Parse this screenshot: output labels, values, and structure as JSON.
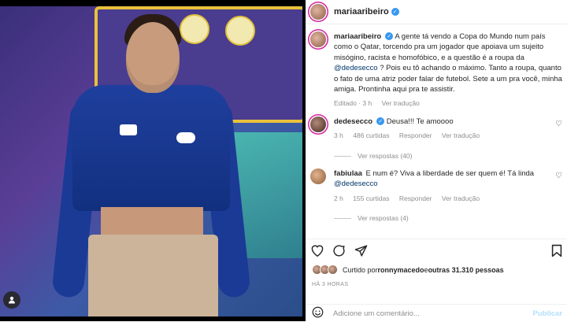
{
  "post": {
    "author": "mariaaribeiro",
    "caption": "A gente tá vendo a Copa do Mundo num país como o Qatar, torcendo pra um jogador que apoiava um sujeito misógino, racista e homofóbico, e a questão é a roupa da",
    "caption_mention": "@dedesecco",
    "caption_rest": " ? Pois eu tô achando o máximo. Tanto a roupa, quanto o fato de uma atriz poder falar de futebol. Sete a um pra você, minha amiga. Prontinha aqui pra te assistir.",
    "caption_edited": "Editado · 3 h",
    "caption_translate": "Ver tradução"
  },
  "comments": [
    {
      "user": "dedesecco",
      "text": "Deusa!!! Te amoooo",
      "time": "3 h",
      "likes": "486 curtidas",
      "reply": "Responder",
      "translate": "Ver tradução",
      "view_replies": "Ver respostas (40)"
    },
    {
      "user": "fabiulaa",
      "text": "E num é? Viva a liberdade de ser quem é! Tá linda",
      "mention": "@dedesecco",
      "time": "2 h",
      "likes": "155 curtidas",
      "reply": "Responder",
      "translate": "Ver tradução",
      "view_replies": "Ver respostas (4)"
    }
  ],
  "likes": {
    "prefix": "Curtido por ",
    "user": "ronnymacedo",
    "middle": " e ",
    "others": "outras 31.310 pessoas"
  },
  "timestamp": "HÁ 3 HORAS",
  "add_comment": {
    "placeholder": "Adicione um comentário...",
    "post_label": "Publicar"
  },
  "icons": {
    "like": "heart-icon",
    "comment": "comment-icon",
    "share": "share-icon",
    "save": "bookmark-icon",
    "emoji": "smiley-icon",
    "user_tags": "person-icon"
  },
  "colors": {
    "verified": "#3897f0",
    "secondary_text": "#8e8e8e",
    "mention": "#00376b",
    "post_disabled": "#b2dffc"
  }
}
